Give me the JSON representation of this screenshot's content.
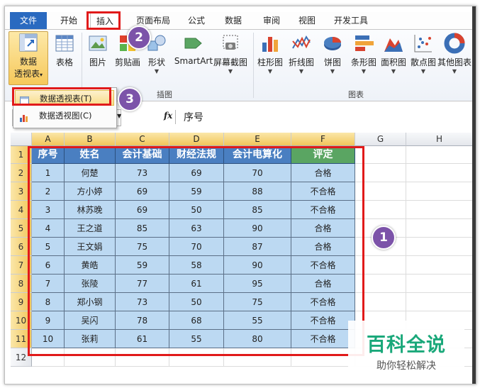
{
  "tabs": [
    "文件",
    "开始",
    "插入",
    "页面布局",
    "公式",
    "数据",
    "审阅",
    "视图",
    "开发工具"
  ],
  "active_tab": "插入",
  "ribbon": {
    "pivot_label_line1": "数据",
    "pivot_label_line2": "透视表",
    "table_label": "表格",
    "picture_label": "图片",
    "clipart_label": "剪贴画",
    "shapes_label": "形状",
    "smartart_label": "SmartArt",
    "screenshot_label": "屏幕截图",
    "illustrations_group": "插图",
    "charts": [
      "柱形图",
      "折线图",
      "饼图",
      "条形图",
      "面积图",
      "散点图",
      "其他图表"
    ],
    "charts_group": "图表"
  },
  "dropdown": {
    "items": [
      "数据透视表(T)",
      "数据透视图(C)"
    ]
  },
  "formula_bar": {
    "fx": "fx",
    "content": "序号"
  },
  "sheet": {
    "columns": [
      "A",
      "B",
      "C",
      "D",
      "E",
      "F",
      "G",
      "H"
    ],
    "rows": [
      "1",
      "2",
      "3",
      "4",
      "5",
      "6",
      "7",
      "8",
      "9",
      "10",
      "11",
      "12"
    ],
    "headers": [
      "序号",
      "姓名",
      "会计基础",
      "财经法规",
      "会计电算化",
      "评定"
    ],
    "data": [
      [
        "1",
        "何楚",
        "73",
        "69",
        "70",
        "合格"
      ],
      [
        "2",
        "方小婷",
        "69",
        "59",
        "88",
        "不合格"
      ],
      [
        "3",
        "林苏晚",
        "69",
        "50",
        "85",
        "不合格"
      ],
      [
        "4",
        "王之道",
        "85",
        "63",
        "90",
        "合格"
      ],
      [
        "5",
        "王文娟",
        "75",
        "70",
        "87",
        "合格"
      ],
      [
        "6",
        "黄皓",
        "59",
        "58",
        "90",
        "不合格"
      ],
      [
        "7",
        "张陵",
        "77",
        "61",
        "95",
        "合格"
      ],
      [
        "8",
        "郑小钢",
        "73",
        "50",
        "75",
        "不合格"
      ],
      [
        "9",
        "吴闪",
        "78",
        "68",
        "55",
        "不合格"
      ],
      [
        "10",
        "张莉",
        "61",
        "55",
        "80",
        "不合格"
      ]
    ]
  },
  "annotations": {
    "step1": "1",
    "step2": "2",
    "step3": "3"
  },
  "watermark": {
    "title": "百科全说",
    "subtitle": "助你轻松解决"
  },
  "colors": {
    "file_tab": "#2a6ac0",
    "header_blue": "#4a7fc1",
    "header_green": "#5aa562",
    "data_fill": "#bcd9f2",
    "highlight_red": "#e11a1a",
    "badge_purple": "#7c53a9",
    "watermark_green": "#1aa87a"
  }
}
